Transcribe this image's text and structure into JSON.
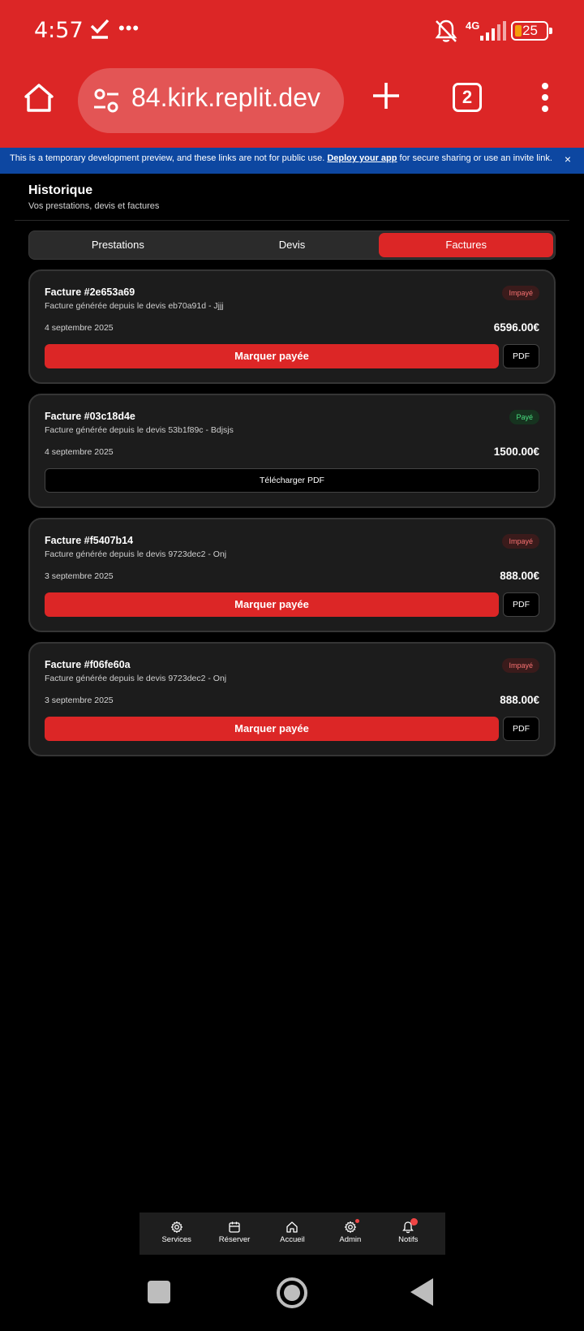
{
  "status_bar": {
    "time": "4:57",
    "dots": "•••",
    "network": "4G",
    "battery": "25"
  },
  "browser": {
    "url": "84.kirk.replit.dev",
    "tab_count": "2"
  },
  "banner": {
    "text_before": "This is a temporary development preview, and these links are not for public use. ",
    "link_text": "Deploy your app",
    "text_after": " for secure sharing or use an invite link.",
    "close": "×"
  },
  "page": {
    "title": "Historique",
    "subtitle": "Vos prestations, devis et factures"
  },
  "tabs": [
    {
      "label": "Prestations",
      "active": false
    },
    {
      "label": "Devis",
      "active": false
    },
    {
      "label": "Factures",
      "active": true
    }
  ],
  "invoices": [
    {
      "title": "Facture #2e653a69",
      "description": "Facture générée depuis le devis eb70a91d - Jjjj",
      "status": "Impayé",
      "paid": false,
      "date": "4 septembre 2025",
      "amount": "6596.00€",
      "pay_label": "Marquer payée",
      "pdf_label": "PDF"
    },
    {
      "title": "Facture #03c18d4e",
      "description": "Facture générée depuis le devis 53b1f89c - Bdjsjs",
      "status": "Payé",
      "paid": true,
      "date": "4 septembre 2025",
      "amount": "1500.00€",
      "download_label": "Télécharger PDF"
    },
    {
      "title": "Facture #f5407b14",
      "description": "Facture générée depuis le devis 9723dec2 - Onj",
      "status": "Impayé",
      "paid": false,
      "date": "3 septembre 2025",
      "amount": "888.00€",
      "pay_label": "Marquer payée",
      "pdf_label": "PDF"
    },
    {
      "title": "Facture #f06fe60a",
      "description": "Facture générée depuis le devis 9723dec2 - Onj",
      "status": "Impayé",
      "paid": false,
      "date": "3 septembre 2025",
      "amount": "888.00€",
      "pay_label": "Marquer payée",
      "pdf_label": "PDF"
    }
  ],
  "bottom_nav": [
    {
      "label": "Services",
      "icon": "gear-icon"
    },
    {
      "label": "Réserver",
      "icon": "calendar-icon"
    },
    {
      "label": "Accueil",
      "icon": "home-icon"
    },
    {
      "label": "Admin",
      "icon": "gear-icon"
    },
    {
      "label": "Notifs",
      "icon": "bell-icon"
    }
  ],
  "colors": {
    "accent": "#dc2626",
    "banner": "#0d47a1",
    "card": "#1c1c1c"
  }
}
